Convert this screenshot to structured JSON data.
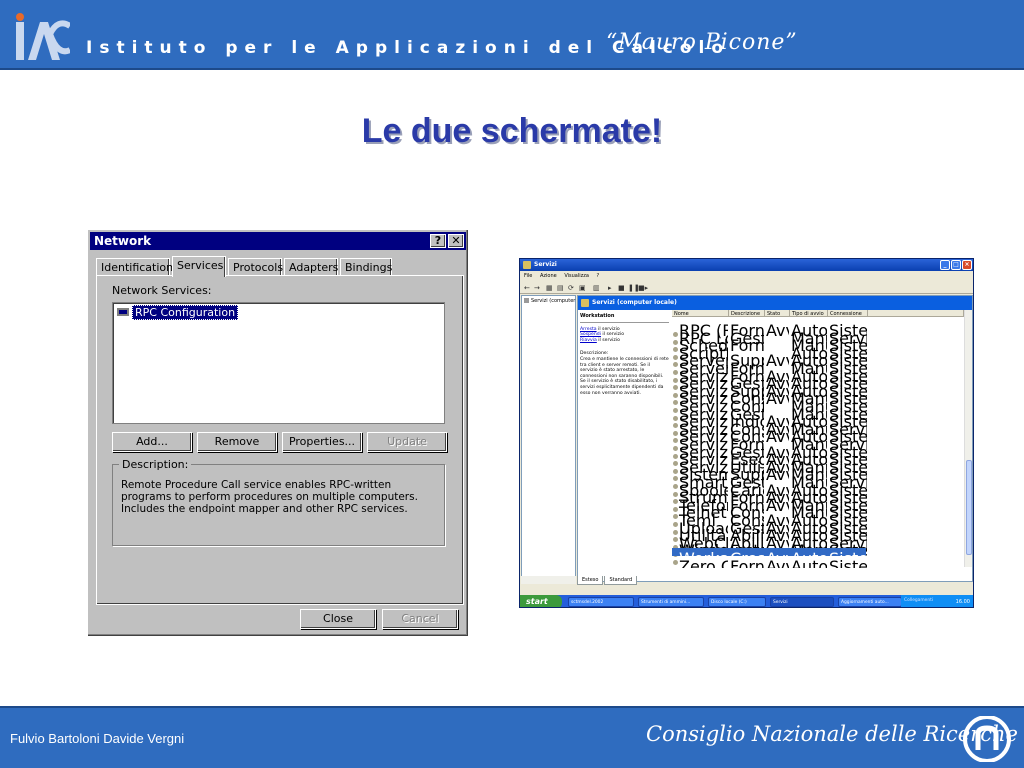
{
  "banner": {
    "logo_text": "IAC",
    "title": "Istituto per le Applicazioni del Calcolo",
    "signature": "“Mauro Picone”"
  },
  "slide": {
    "title": "Le due schermate!"
  },
  "nt_dialog": {
    "title": "Network",
    "help_btn": "?",
    "close_btn": "✕",
    "tabs": [
      "Identification",
      "Services",
      "Protocols",
      "Adapters",
      "Bindings"
    ],
    "active_tab": "Services",
    "list_label": "Network Services:",
    "list_items": [
      "RPC Configuration"
    ],
    "buttons": {
      "add": "Add...",
      "remove": "Remove",
      "properties": "Properties...",
      "update": "Update"
    },
    "description_label": "Description:",
    "description": "Remote Procedure Call service enables RPC-written programs to perform procedures on multiple computers. Includes the endpoint mapper and other RPC services.",
    "close": "Close",
    "cancel": "Cancel"
  },
  "xp_window": {
    "title": "Servizi",
    "menu": [
      "File",
      "Azione",
      "Visualizza",
      "?"
    ],
    "tree_item": "Servizi (computer loc",
    "header": "Servizi (computer locale)",
    "selected_service": "Workstation",
    "links": {
      "stop": "Arresta",
      "stop_suffix": " il servizio",
      "pause": "Sospendi",
      "pause_suffix": " il servizio",
      "restart": "Riavvia",
      "restart_suffix": " il servizio"
    },
    "description_label": "Descrizione:",
    "description": "Crea e mantiene le connessioni di rete tra client e server remoti. Se il servizio è stato arrestato, le connessioni non saranno disponibili. Se il servizio è stato disabilitato, i servizi esplicitamente dipendenti da esso non verranno avviati.",
    "columns": [
      "Nome",
      "Descrizione",
      "Stato",
      "Tipo di avvio",
      "Connessione"
    ],
    "rows": [
      [
        "RPC (Remote Proce...",
        "Fornisce il ...",
        "Avviato",
        "Automatico",
        "Sistema locale"
      ],
      [
        "RPC Locator",
        "Gestisce il ...",
        "",
        "Manuale",
        "Servizio di rete"
      ],
      [
        "Scheda WMI Perfor...",
        "Fornisce inf...",
        "",
        "Manuale",
        "Sistema locale"
      ],
      [
        "ScriptBlocking Service",
        "",
        "",
        "Automatico",
        "Sistema locale"
      ],
      [
        "Server",
        "Supporta la...",
        "Avviato",
        "Automatico",
        "Sistema locale"
      ],
      [
        "Server di stampe T...",
        "Fornisce un...",
        "",
        "Manuale",
        "Sistema locale"
      ],
      [
        "Servizi di crittografia",
        "Fornisce tr...",
        "Avviato",
        "Automatico",
        "Sistema locale"
      ],
      [
        "Servizi IPSEC",
        "Gestisce la ...",
        "Avviato",
        "Automatico",
        "Sistema locale"
      ],
      [
        "Servizi semplici TCP/IP",
        "Supporta i ...",
        "Avviato",
        "Automatico",
        "Sistema locale"
      ],
      [
        "Servizi terminal",
        "Consente a ...",
        "Avviato",
        "Manuale",
        "Sistema locale"
      ],
      [
        "Servizio amministrat...",
        "Configura I...",
        "",
        "Manuale",
        "Sistema locale"
      ],
      [
        "Servizio COM di mas...",
        "Gestisce la ...",
        "",
        "Manuale",
        "Sistema locale"
      ],
      [
        "Servizio di indicizzaz...",
        "Indicizza co...",
        "Avviato",
        "Automatico",
        "Sistema locale"
      ],
      [
        "Servizio di rilevame...",
        "Consente il...",
        "Avviato",
        "Manuale",
        "Servizio locale"
      ],
      [
        "Servizio di segnalazi...",
        "Consente i...",
        "Avviato",
        "Automatico",
        "Sistema locale"
      ],
      [
        "Servizio Gateway di...",
        "Fornisce su...",
        "",
        "Manuale",
        "Servizio locale"
      ],
      [
        "Servizio Norton Anti...",
        "Gestisce gli...",
        "Avviato",
        "Automatico",
        "Sistema locale"
      ],
      [
        "Servizio Ripristino c...",
        "Esegue le f...",
        "Avviato",
        "Automatico",
        "Sistema locale"
      ],
      [
        "Servizio di trasferimen...",
        "Utilizza la la...",
        "Avviato",
        "Manuale",
        "Sistema locale"
      ],
      [
        "Sistema di eventi C...",
        "Supporta il ...",
        "Avviato",
        "Manuale",
        "Sistema locale"
      ],
      [
        "Smart card",
        "Gestisce l'a...",
        "",
        "Manuale",
        "Servizio locale"
      ],
      [
        "Spooler di stampa",
        "Carica i file ...",
        "Avviato",
        "Automatico",
        "Sistema locale"
      ],
      [
        "Strumentazione ges...",
        "Fornisce un...",
        "Avviato",
        "Automatico",
        "Sistema locale"
      ],
      [
        "Telefonia",
        "Fornisce su...",
        "Avviato",
        "Manuale",
        "Sistema locale"
      ],
      [
        "Telnet",
        "Consente a ...",
        "",
        "Manuale",
        "Sistema locale"
      ],
      [
        "Temi",
        "Consente l...",
        "Avviato",
        "Automatico",
        "Sistema locale"
      ],
      [
        "Upload Manager",
        "Gestisce i t...",
        "Avviato",
        "Automatico",
        "Sistema locale"
      ],
      [
        "Utilità di pianificazione",
        "Abilita l'ute...",
        "Avviato",
        "Automatico",
        "Sistema locale"
      ],
      [
        "WebClient",
        "Abilita i pro...",
        "Avviato",
        "Automatico",
        "Servizio locale"
      ],
      [
        "Windows Installer",
        "Installa, rip...",
        "",
        "Manuale",
        "Sistema locale"
      ],
      [
        "Workstation",
        "Crea e man...",
        "Avviato",
        "Automatico",
        "Sistema locale"
      ],
      [
        "Zero Configuration ...",
        "Fornisce la ...",
        "Avviato",
        "Automatico",
        "Sistema locale"
      ]
    ],
    "selected_row_index": 30,
    "bottom_tabs": [
      "Esteso",
      "Standard"
    ],
    "taskbar": {
      "start": "start",
      "tasks": [
        "sctmsdel.2002",
        "Strumenti di ammini...",
        "Disco locale (C:)",
        "Servizi",
        "Aggiornamenti auto..."
      ],
      "tray_label": "Collegamenti",
      "clock": "16.00"
    }
  },
  "footer": {
    "authors": "Fulvio Bartoloni Davide Vergni",
    "institution": "Consiglio Nazionale delle Ricerche"
  }
}
